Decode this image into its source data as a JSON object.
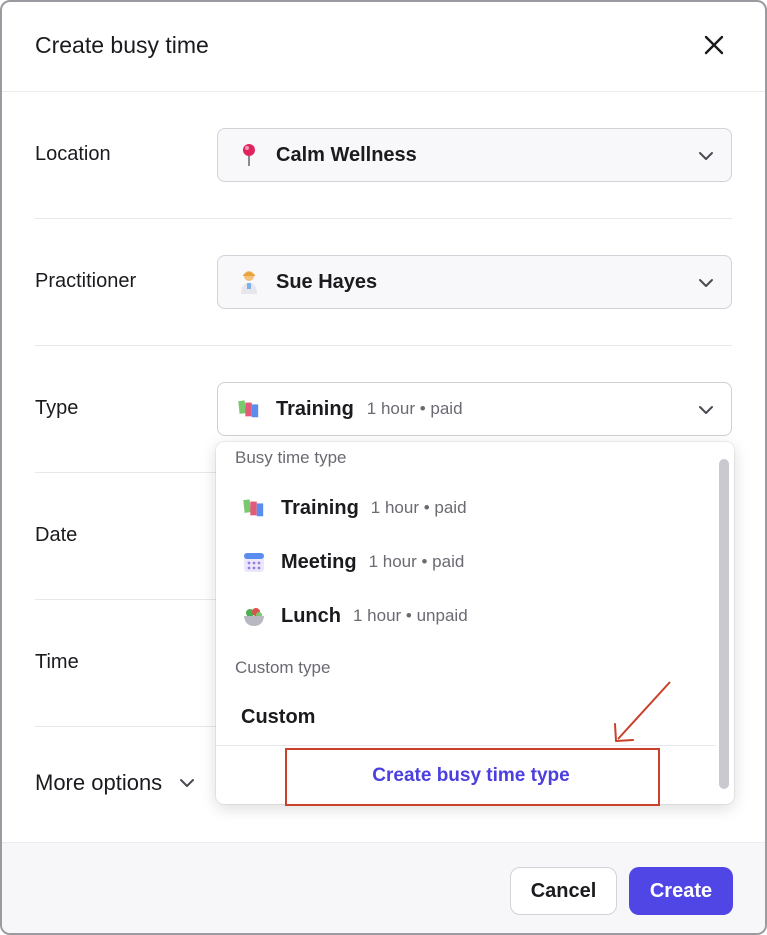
{
  "dialog": {
    "title": "Create busy time"
  },
  "form": {
    "location": {
      "label": "Location",
      "value": "Calm Wellness",
      "icon": "pin-icon"
    },
    "practitioner": {
      "label": "Practitioner",
      "value": "Sue Hayes",
      "icon": "health-worker-icon"
    },
    "type": {
      "label": "Type",
      "value": "Training",
      "meta": "1 hour • paid",
      "icon": "books-icon"
    },
    "date": {
      "label": "Date"
    },
    "time": {
      "label": "Time"
    },
    "more_options": "More options"
  },
  "dropdown": {
    "group1_label": "Busy time type",
    "items": [
      {
        "name": "Training",
        "meta": "1 hour • paid",
        "icon": "books-icon"
      },
      {
        "name": "Meeting",
        "meta": "1 hour • paid",
        "icon": "calendar-icon"
      },
      {
        "name": "Lunch",
        "meta": "1 hour • unpaid",
        "icon": "salad-icon"
      }
    ],
    "group2_label": "Custom type",
    "custom_label": "Custom",
    "action_label": "Create busy time type"
  },
  "footer": {
    "cancel_label": "Cancel",
    "create_label": "Create"
  },
  "colors": {
    "primary": "#5046e5",
    "link": "#4b3fe0",
    "annotation": "#c9402b"
  }
}
